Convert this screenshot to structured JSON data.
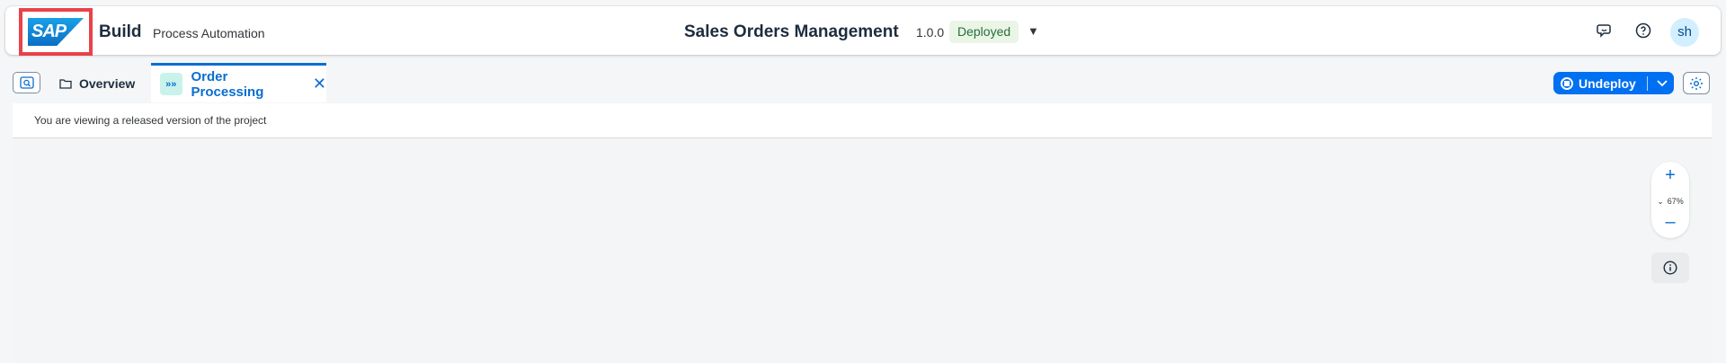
{
  "header": {
    "logo_text": "SAP",
    "product": "Build",
    "subtitle": "Process Automation",
    "project_title": "Sales Orders Management",
    "version": "1.0.0",
    "status": "Deployed",
    "status_color": "#256f3a",
    "icons": [
      "feedback-icon",
      "help-icon"
    ],
    "user_initials": "sh"
  },
  "tabs": {
    "overview_label": "Overview",
    "active_label": "Order Processing",
    "active_chip": "»»"
  },
  "actions": {
    "undeploy_label": "Undeploy",
    "accent": "#0070f2"
  },
  "notice": {
    "text": "You are viewing a released version of the project"
  },
  "zoom": {
    "level": "67%"
  }
}
